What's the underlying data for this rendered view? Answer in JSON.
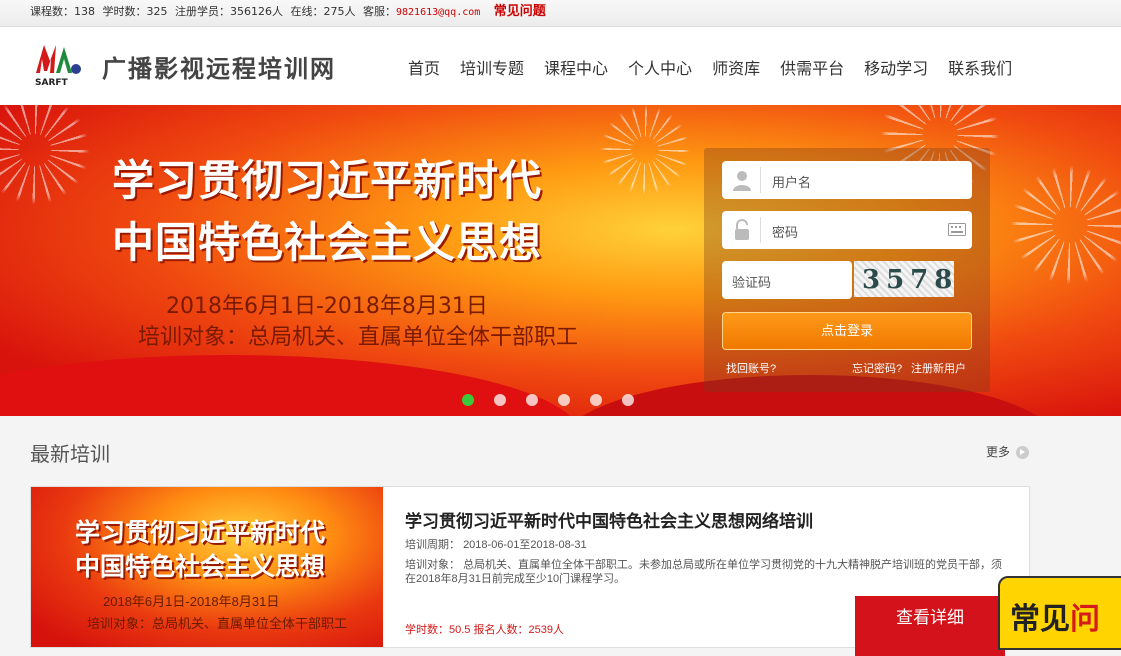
{
  "topbar": {
    "courses": "课程数：138",
    "hours": "学时数：325",
    "registered": "注册学员：356126人",
    "online": "在线：275人",
    "service_label": "客服：",
    "service_email": "9821613@qq.com",
    "faq": "常见问题"
  },
  "header": {
    "logo_text": "SARFT",
    "site_name": "广播影视远程培训网",
    "nav": [
      "首页",
      "培训专题",
      "课程中心",
      "个人中心",
      "师资库",
      "供需平台",
      "移动学习",
      "联系我们"
    ]
  },
  "banner": {
    "title_line1": "学习贯彻习近平新时代",
    "title_line2": "中国特色社会主义思想",
    "date_range": "2018年6月1日-2018年8月31日",
    "target": "培训对象：总局机关、直属单位全体干部职工",
    "slide_count": 6,
    "active_slide": 1
  },
  "login": {
    "username_placeholder": "用户名",
    "password_placeholder": "密码",
    "captcha_placeholder": "验证码",
    "captcha_code": "3578",
    "submit": "点击登录",
    "recover_account": "找回账号?",
    "forgot_password": "忘记密码?",
    "register": "注册新用户"
  },
  "latest": {
    "section_title": "最新培训",
    "more": "更多",
    "card": {
      "thumb_line1": "学习贯彻习近平新时代",
      "thumb_line2": "中国特色社会主义思想",
      "thumb_date": "2018年6月1日-2018年8月31日",
      "thumb_target": "培训对象：总局机关、直属单位全体干部职工",
      "title": "学习贯彻习近平新时代中国特色社会主义思想网络培训",
      "period_label": "培训周期：",
      "period_value": "2018-06-01至2018-08-31",
      "target_label": "培训对象：",
      "target_value": "总局机关、直属单位全体干部职工。未参加总局或所在单位学习贯彻党的十九大精神脱产培训班的党员干部，须在2018年8月31日前完成至少10门课程学习。",
      "stats": "学时数：50.5  报名人数：2539人",
      "detail_button": "查看详细"
    }
  },
  "float_faq": {
    "text_a": "常见",
    "text_b": "问"
  },
  "colors": {
    "accent_red": "#d3121b",
    "login_orange": "#f58a0c",
    "active_dot": "#3bc83b"
  }
}
